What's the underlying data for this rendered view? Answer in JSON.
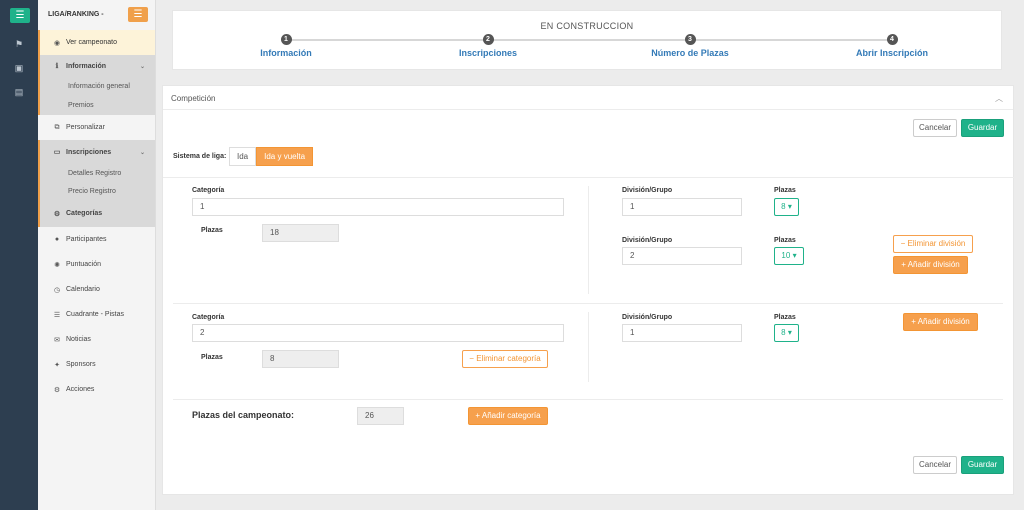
{
  "sidebar": {
    "title": "LIGA/RANKING -",
    "toggle_icon": "☰",
    "items": [
      {
        "label": "Ver campeonato",
        "icon": "eye-icon"
      },
      {
        "label": "Información",
        "icon": "info-icon"
      },
      {
        "label": "Información general"
      },
      {
        "label": "Premios"
      },
      {
        "label": "Personalizar",
        "icon": "sitemap-icon"
      },
      {
        "label": "Inscripciones",
        "icon": "keyboard-icon"
      },
      {
        "label": "Detalles Registro"
      },
      {
        "label": "Precio Registro"
      },
      {
        "label": "Categorías",
        "icon": "gear-icon"
      },
      {
        "label": "Participantes",
        "icon": "user-icon"
      },
      {
        "label": "Puntuación",
        "icon": "trophy-icon"
      },
      {
        "label": "Calendario",
        "icon": "clock-icon"
      },
      {
        "label": "Cuadrante - Pistas",
        "icon": "list-icon"
      },
      {
        "label": "Noticias",
        "icon": "comment-icon"
      },
      {
        "label": "Sponsors",
        "icon": "gift-icon"
      },
      {
        "label": "Acciones",
        "icon": "gear-icon"
      }
    ]
  },
  "stepper": {
    "title": "EN CONSTRUCCION",
    "steps": [
      {
        "num": "1",
        "label": "Información"
      },
      {
        "num": "2",
        "label": "Inscripciones"
      },
      {
        "num": "3",
        "label": "Número de Plazas"
      },
      {
        "num": "4",
        "label": "Abrir Inscripción"
      }
    ]
  },
  "panel": {
    "title": "Competición",
    "cancel_label": "Cancelar",
    "save_label": "Guardar",
    "league_system_label": "Sistema de liga:",
    "league_options": [
      "Ida",
      "Ida y vuelta"
    ],
    "categories": [
      {
        "category_label": "Categoría",
        "category_value": "1",
        "seats_label": "Plazas",
        "seats_value": "18",
        "divisions": [
          {
            "label": "División/Grupo",
            "value": "1",
            "seats_label": "Plazas",
            "seats_value": "8"
          },
          {
            "label": "División/Grupo",
            "value": "2",
            "seats_label": "Plazas",
            "seats_value": "10"
          }
        ],
        "remove_division_label": "Eliminar división",
        "add_division_label": "Añadir división"
      },
      {
        "category_label": "Categoría",
        "category_value": "2",
        "seats_label": "Plazas",
        "seats_value": "8",
        "remove_category_label": "Eliminar categoría",
        "divisions": [
          {
            "label": "División/Grupo",
            "value": "1",
            "seats_label": "Plazas",
            "seats_value": "8"
          }
        ],
        "add_division_label": "Añadir división"
      }
    ],
    "total_label": "Plazas del campeonato:",
    "total_value": "26",
    "add_category_label": "Añadir categoría"
  },
  "colors": {
    "accent_orange": "#f6a04d",
    "accent_green": "#1fb28a",
    "link_blue": "#337ab7",
    "rail": "#2d3e50"
  }
}
